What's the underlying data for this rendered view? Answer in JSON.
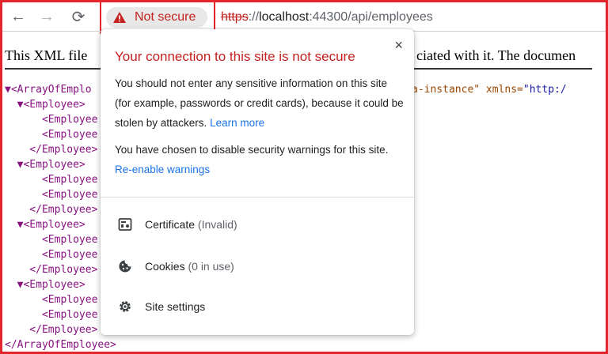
{
  "toolbar": {
    "back_icon": "←",
    "forward_icon": "→",
    "reload_icon": "⟳",
    "security_chip_label": "Not secure",
    "url_scheme": "https",
    "url_sep": "://",
    "url_host": "localhost",
    "url_path": ":44300/api/employees"
  },
  "page": {
    "intro_left": "This XML file",
    "intro_right": "ciated with it. The documen",
    "xml_lines": [
      "▼<ArrayOfEmplo",
      "  ▼<Employee>",
      "      <Employee",
      "      <Employee",
      "    </Employee>",
      "  ▼<Employee>",
      "      <Employee",
      "      <Employee",
      "    </Employee>",
      "  ▼<Employee>",
      "      <Employee",
      "      <Employee",
      "    </Employee>",
      "  ▼<Employee>",
      "      <Employee",
      "      <Employee",
      "    </Employee>",
      "</ArrayOfEmployee>"
    ],
    "xml_attr_fragment": "a-instance\"",
    "xml_attr_name": " xmlns=",
    "xml_attr_value": "\"http:/"
  },
  "popup": {
    "close_label": "×",
    "title": "Your connection to this site is not secure",
    "para1": "You should not enter any sensitive information on this site (for example, passwords or credit cards), because it could be stolen by attackers.",
    "para1_link": "Learn more",
    "para2": "You have chosen to disable security warnings for this site.",
    "para2_link": "Re-enable warnings",
    "certificate_label": "Certificate",
    "certificate_sub": "(Invalid)",
    "cookies_label": "Cookies",
    "cookies_sub": "(0 in use)",
    "site_settings_label": "Site settings"
  },
  "colors": {
    "warning_red": "#c5221f",
    "link_blue": "#1a73e8",
    "highlight_red": "#e3262c"
  }
}
